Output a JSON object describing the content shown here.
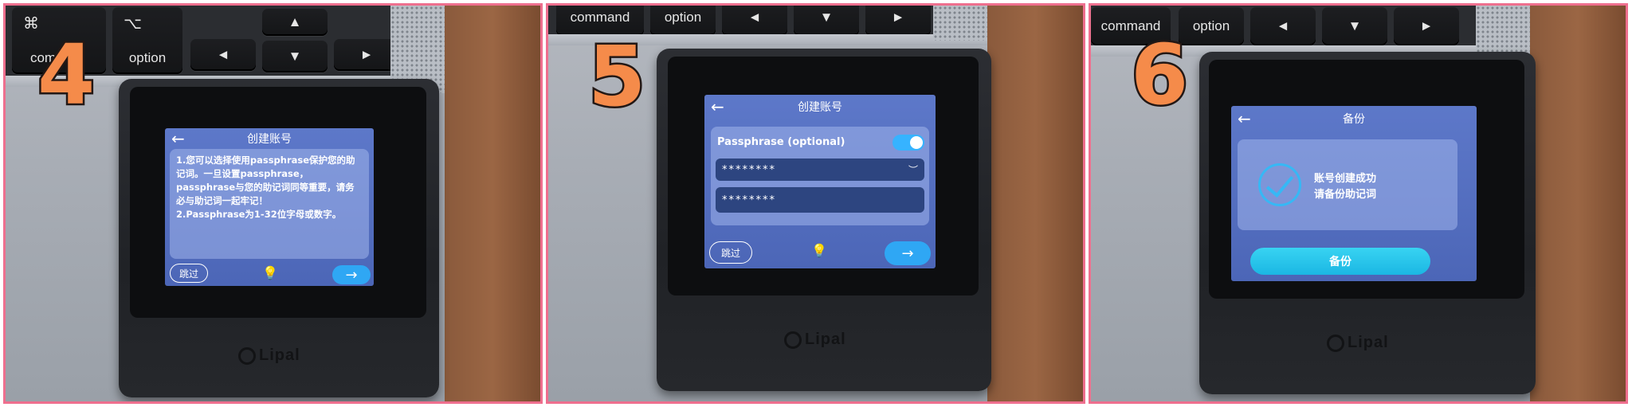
{
  "steps": [
    {
      "number": "4",
      "keys": {
        "cmd_symbol": "⌘",
        "cmd_label": "com",
        "opt_symbol": "⌥",
        "opt_label": "option"
      },
      "screen": {
        "title": "创建账号",
        "text": "1.您可以选择使用passphrase保护您的助记词。一旦设置passphrase，passphrase与您的助记词同等重要，请务必与助记词一起牢记！\n2.Passphrase为1-32位字母或数字。",
        "skip": "跳过"
      }
    },
    {
      "number": "5",
      "keys": {
        "cmd_label": "command",
        "opt_label": "option"
      },
      "screen": {
        "title": "创建账号",
        "passphrase_label": "Passphrase (optional)",
        "field1": "********",
        "field2": "********",
        "skip": "跳过"
      }
    },
    {
      "number": "6",
      "keys": {
        "cmd_label": "command",
        "opt_label": "option"
      },
      "screen": {
        "title": "备份",
        "msg_line1": "账号创建成功",
        "msg_line2": "请备份助记词",
        "backup": "备份"
      }
    }
  ],
  "arrow_left": "◄",
  "arrow_right": "►",
  "arrow_up": "▲",
  "arrow_down": "▼",
  "back_glyph": "←",
  "next_glyph": "→",
  "bulb_glyph": "💡",
  "eye_glyph": "︶",
  "brand": "Lipal",
  "colors": {
    "frame": "#ee6f8e",
    "number": "#f58b4a",
    "screen": "#5d78c9",
    "accent": "#2fa7f4"
  }
}
